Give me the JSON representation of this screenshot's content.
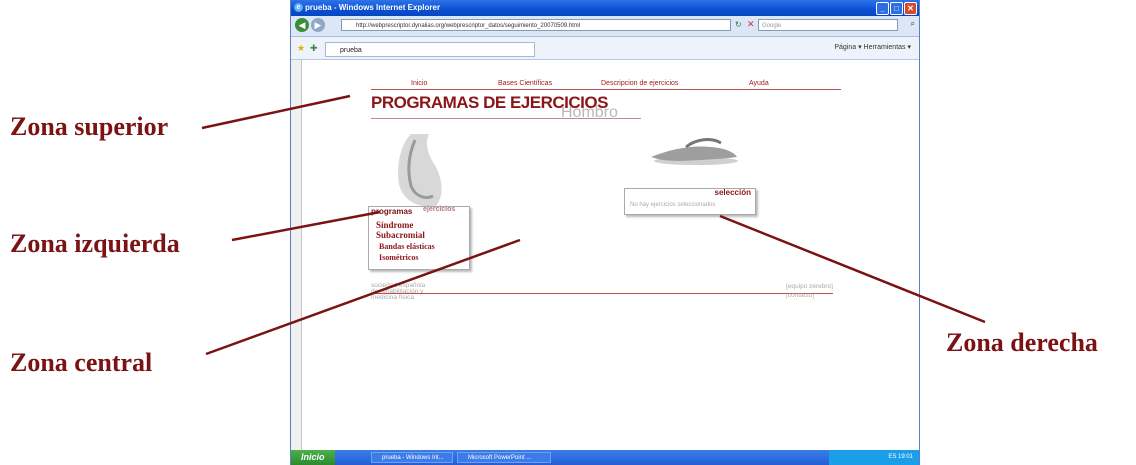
{
  "annotations": {
    "superior": "Zona superior",
    "izquierda": "Zona izquierda",
    "central": "Zona central",
    "derecha": "Zona derecha"
  },
  "browser": {
    "title": "prueba - Windows Internet Explorer",
    "url": "http://webprescriptor.dynalias.org/webprescriptor_datos/seguimiento_20070509.html",
    "search_placeholder": "Google",
    "tab_label": "prueba",
    "tools": "Página ▾  Herramientas ▾"
  },
  "page": {
    "nav": [
      "Inicio",
      "Bases Científicas",
      "Descripcion de ejercicios",
      "Ayuda"
    ],
    "title": "PROGRAMAS DE EJERCICIOS",
    "subtitle": "Hombro",
    "left_panel": {
      "tab_programas": "programas",
      "tab_ejercicios": "ejercicios",
      "items": [
        "Síndrome",
        "Subacromial",
        "Bandas elásticas",
        "Isométricos"
      ]
    },
    "right_panel": {
      "heading": "selección",
      "empty_text": "No hay ejercicios seleccionados"
    },
    "footer_left": [
      "sociedad española",
      "de rehabilitación y",
      "medicina física"
    ],
    "footer_right": [
      "[equipo zerebro]",
      "[contacto]"
    ]
  },
  "taskbar": {
    "start": "Inicio",
    "tasks": [
      "prueba - Windows Int...",
      "Microsoft PowerPoint ..."
    ],
    "tray": "ES  19:01"
  },
  "colors": {
    "annotation": "#7b1214",
    "brand": "#8c1519"
  }
}
